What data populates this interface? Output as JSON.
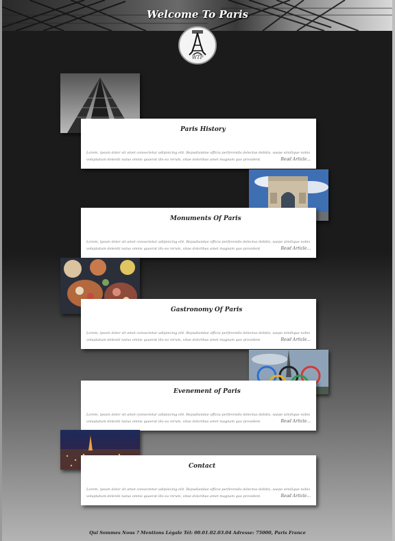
{
  "header": {
    "title": "Welcome To Paris",
    "logo_text": "WTP"
  },
  "articles": [
    {
      "title": "Paris History",
      "body": "Lorem, ipsum dolor sit amet consectetur adipisicing elit. Repudiandae officia perferendis delectus debitis, saepe similique nobis voluptatum deleniti natus omnis quaerat illo ea rerum, vitae doloribus amet magnam quo provident.",
      "read_more": "Read Article...",
      "image": "eiffel-tower-photo"
    },
    {
      "title": "Monuments Of Paris",
      "body": "Lorem, ipsum dolor sit amet consectetur adipisicing elit. Repudiandae officia perferendis delectus debitis, saepe similique nobis voluptatum deleniti natus omnis quaerat illo ea rerum, vitae doloribus amet magnam quo provident.",
      "read_more": "Read Article...",
      "image": "arc-de-triomphe-photo"
    },
    {
      "title": "Gastronomy Of Paris",
      "body": "Lorem, ipsum dolor sit amet consectetur adipisicing elit. Repudiandae officia perferendis delectus debitis, saepe similique nobis voluptatum deleniti natus omnis quaerat illo ea rerum, vitae doloribus amet magnam quo provident.",
      "read_more": "Read Article...",
      "image": "food-platter-photo"
    },
    {
      "title": "Evenement of Paris",
      "body": "Lorem, ipsum dolor sit amet consectetur adipisicing elit. Repudiandae officia perferendis delectus debitis, saepe similique nobis voluptatum deleniti natus omnis quaerat illo ea rerum, vitae doloribus amet magnam quo provident.",
      "read_more": "Read Article...",
      "image": "olympic-rings-photo"
    },
    {
      "title": "Contact",
      "body": "Lorem, ipsum dolor sit amet consectetur adipisicing elit. Repudiandae officia perferendis delectus debitis, saepe similique nobis voluptatum deleniti natus omnis quaerat illo ea rerum, vitae doloribus amet magnam quo provident.",
      "read_more": "Read Article...",
      "image": "paris-night-photo"
    }
  ],
  "footer": {
    "text": "Qui Sommes Nous ? Mentions Légale Tél: 00.01.02.03.04 Adresse: 75000, Paris France"
  }
}
